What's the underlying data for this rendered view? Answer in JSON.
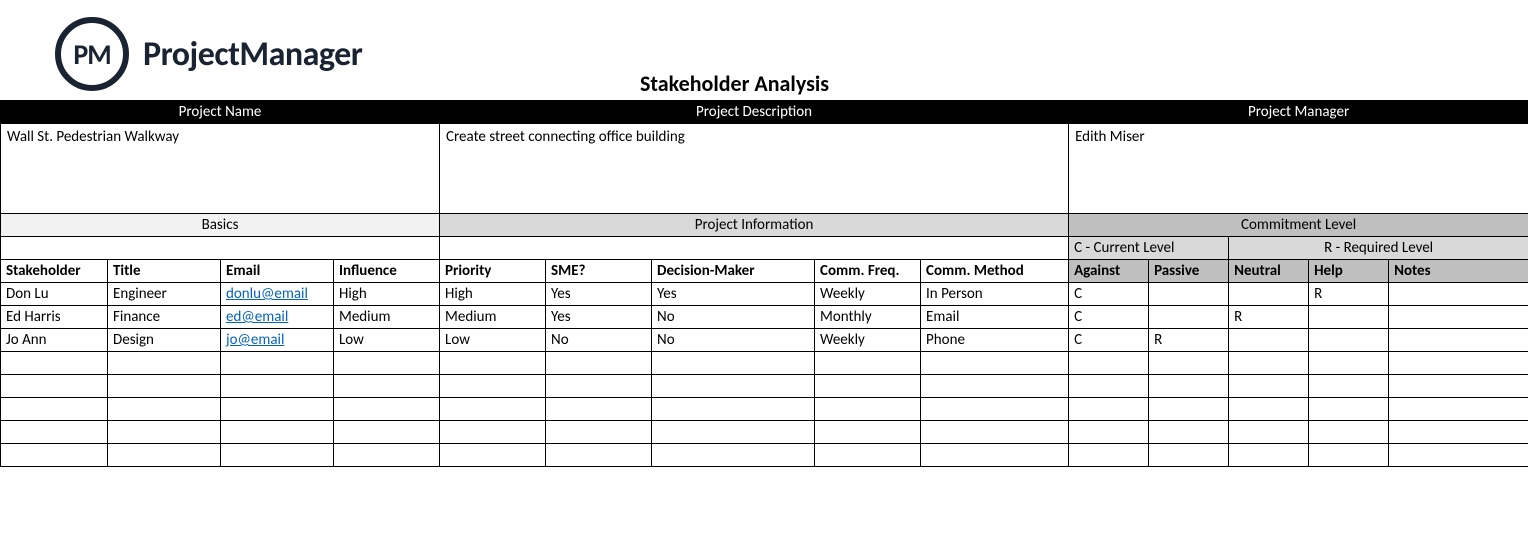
{
  "brand": {
    "abbr": "PM",
    "name": "ProjectManager"
  },
  "title": "Stakeholder Analysis",
  "meta_headers": {
    "project_name": "Project Name",
    "project_desc": "Project Description",
    "project_mgr": "Project Manager"
  },
  "meta": {
    "project_name": "Wall St. Pedestrian Walkway",
    "project_desc": "Create street connecting office building",
    "project_mgr": "Edith Miser"
  },
  "sections": {
    "basics": "Basics",
    "project_info": "Project Information",
    "commitment": "Commitment Level"
  },
  "legend": {
    "current": "C - Current Level",
    "required": "R - Required Level"
  },
  "columns": {
    "stakeholder": "Stakeholder",
    "title": "Title",
    "email": "Email",
    "influence": "Influence",
    "priority": "Priority",
    "sme": "SME?",
    "decision": "Decision-Maker",
    "freq": "Comm. Freq.",
    "method": "Comm. Method",
    "against": "Against",
    "passive": "Passive",
    "neutral": "Neutral",
    "help": "Help",
    "notes": "Notes"
  },
  "rows": [
    {
      "stakeholder": "Don Lu",
      "title": "Engineer",
      "email": "donlu@email",
      "influence": "High",
      "priority": "High",
      "sme": "Yes",
      "decision": "Yes",
      "freq": "Weekly",
      "method": "In Person",
      "against": "C",
      "passive": "",
      "neutral": "",
      "help": "R",
      "notes": ""
    },
    {
      "stakeholder": "Ed Harris",
      "title": "Finance",
      "email": "ed@email",
      "influence": "Medium",
      "priority": "Medium",
      "sme": "Yes",
      "decision": "No",
      "freq": "Monthly",
      "method": "Email",
      "against": "C",
      "passive": "",
      "neutral": "R",
      "help": "",
      "notes": ""
    },
    {
      "stakeholder": "Jo Ann",
      "title": "Design",
      "email": "jo@email",
      "influence": "Low",
      "priority": "Low",
      "sme": "No",
      "decision": "No",
      "freq": "Weekly",
      "method": "Phone",
      "against": "C",
      "passive": "R",
      "neutral": "",
      "help": "",
      "notes": ""
    }
  ],
  "empty_rows": 5
}
